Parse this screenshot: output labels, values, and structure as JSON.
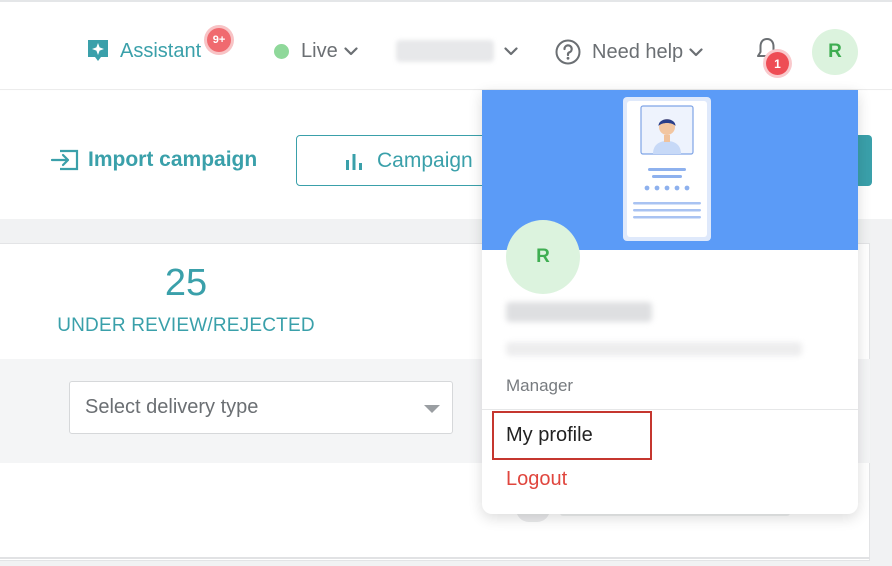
{
  "header": {
    "assistant_label": "Assistant",
    "assistant_badge": "9+",
    "status_label": "Live",
    "help_label": "Need help",
    "notification_count": "1",
    "avatar_initial": "R"
  },
  "toolbar": {
    "import_label": "Import campaign",
    "campaign_label": "Campaign"
  },
  "stats": {
    "count": "25",
    "label": "UNDER REVIEW/REJECTED"
  },
  "filters": {
    "delivery_type_placeholder": "Select delivery type"
  },
  "profile_menu": {
    "avatar_initial": "R",
    "role": "Manager",
    "my_profile_label": "My profile",
    "logout_label": "Logout"
  },
  "colors": {
    "accent": "#3aa0aa",
    "banner": "#5b9bf7",
    "avatar_bg": "#dcf3de",
    "avatar_fg": "#3fae52",
    "danger": "#e0463e",
    "highlight_box": "#c5362f",
    "live_dot": "#8fd89a"
  },
  "icons": {
    "assistant": "sparkle-icon",
    "status": "status-dot-icon",
    "dropdown": "chevron-down-icon",
    "help": "question-circle-icon",
    "notifications": "bell-icon",
    "import": "import-icon",
    "campaign": "bar-chart-icon",
    "select": "caret-down-icon"
  }
}
